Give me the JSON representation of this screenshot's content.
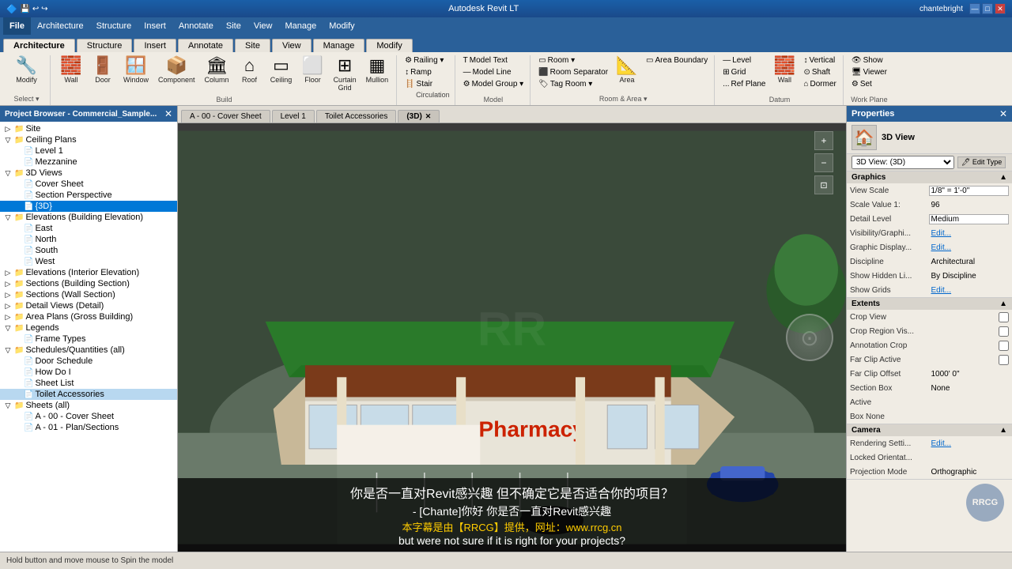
{
  "app": {
    "title": "Autodesk Revit LT",
    "user": "chantebright"
  },
  "titlebar": {
    "controls": [
      "—",
      "□",
      "✕"
    ]
  },
  "menubar": {
    "items": [
      "File",
      "Architecture",
      "Structure",
      "Insert",
      "Annotate",
      "Site",
      "View",
      "Manage",
      "Modify"
    ]
  },
  "ribbon": {
    "active_tab": "Architecture",
    "groups": [
      {
        "label": "",
        "items": [
          {
            "icon": "🔧",
            "label": "Modify"
          }
        ]
      },
      {
        "label": "Build",
        "items": [
          {
            "icon": "🧱",
            "label": "Wall"
          },
          {
            "icon": "🚪",
            "label": "Door"
          },
          {
            "icon": "🪟",
            "label": "Window"
          },
          {
            "icon": "📦",
            "label": "Component"
          },
          {
            "icon": "🏛",
            "label": "Column"
          },
          {
            "icon": "🏠",
            "label": "Roof"
          },
          {
            "icon": "▭",
            "label": "Ceiling"
          },
          {
            "icon": "⬜",
            "label": "Floor"
          },
          {
            "icon": "⬛",
            "label": "Curtain Grid"
          },
          {
            "icon": "▦",
            "label": "Mullion"
          }
        ]
      },
      {
        "label": "",
        "items": [
          {
            "icon": "⚙",
            "label": "Railing"
          },
          {
            "icon": "↕",
            "label": "Ramp"
          },
          {
            "icon": "🪜",
            "label": "Stair Circulation"
          }
        ]
      },
      {
        "label": "Model",
        "items": [
          {
            "icon": "T",
            "label": "Model Text"
          },
          {
            "icon": "—",
            "label": "Model Line"
          },
          {
            "icon": "⚙",
            "label": "Model Group"
          }
        ]
      },
      {
        "label": "Room & Area",
        "items": [
          {
            "icon": "▭",
            "label": "Room"
          },
          {
            "icon": "⬛",
            "label": "Room Separator"
          },
          {
            "icon": "🏷",
            "label": "Tag Room"
          },
          {
            "icon": "📐",
            "label": "Area"
          },
          {
            "icon": "▭",
            "label": "Area Boundary"
          }
        ]
      }
    ],
    "stair_label": "Stair",
    "circulation_label": "Circulation"
  },
  "project_browser": {
    "title": "Project Browser - Commercial_Sample...",
    "tree": [
      {
        "level": 0,
        "label": "Site",
        "type": "item",
        "expanded": false
      },
      {
        "level": 0,
        "label": "Ceiling Plans",
        "type": "group",
        "expanded": true
      },
      {
        "level": 1,
        "label": "Level 1",
        "type": "item"
      },
      {
        "level": 1,
        "label": "Mezzanine",
        "type": "item"
      },
      {
        "level": 0,
        "label": "3D Views",
        "type": "group",
        "expanded": true
      },
      {
        "level": 1,
        "label": "Cover Sheet",
        "type": "item"
      },
      {
        "level": 1,
        "label": "Section Perspective",
        "type": "item"
      },
      {
        "level": 1,
        "label": "{3D}",
        "type": "item",
        "selected": true
      },
      {
        "level": 0,
        "label": "Elevations (Building Elevation)",
        "type": "group",
        "expanded": true
      },
      {
        "level": 1,
        "label": "East",
        "type": "item"
      },
      {
        "level": 1,
        "label": "North",
        "type": "item"
      },
      {
        "level": 1,
        "label": "South",
        "type": "item"
      },
      {
        "level": 1,
        "label": "West",
        "type": "item"
      },
      {
        "level": 0,
        "label": "Elevations (Interior Elevation)",
        "type": "group",
        "expanded": false
      },
      {
        "level": 0,
        "label": "Sections (Building Section)",
        "type": "group",
        "expanded": false
      },
      {
        "level": 0,
        "label": "Sections (Wall Section)",
        "type": "group",
        "expanded": false
      },
      {
        "level": 0,
        "label": "Detail Views (Detail)",
        "type": "group",
        "expanded": false
      },
      {
        "level": 0,
        "label": "Area Plans (Gross Building)",
        "type": "group",
        "expanded": false
      },
      {
        "level": 0,
        "label": "Legends",
        "type": "group",
        "expanded": true
      },
      {
        "level": 1,
        "label": "Frame Types",
        "type": "item"
      },
      {
        "level": 0,
        "label": "Schedules/Quantities (all)",
        "type": "group",
        "expanded": true
      },
      {
        "level": 1,
        "label": "Door Schedule",
        "type": "item"
      },
      {
        "level": 1,
        "label": "How Do I",
        "type": "item"
      },
      {
        "level": 1,
        "label": "Sheet List",
        "type": "item"
      },
      {
        "level": 1,
        "label": "Toilet Accessories",
        "type": "item",
        "highlighted": true
      },
      {
        "level": 0,
        "label": "Sheets (all)",
        "type": "group",
        "expanded": true
      },
      {
        "level": 1,
        "label": "A - 00 - Cover Sheet",
        "type": "item"
      },
      {
        "level": 1,
        "label": "A - 01 - Plan/Sections",
        "type": "item"
      }
    ]
  },
  "tabs": [
    {
      "label": "A - 00 - Cover Sheet",
      "active": false,
      "closeable": false
    },
    {
      "label": "Level 1",
      "active": false,
      "closeable": false
    },
    {
      "label": "Toilet Accessories",
      "active": false,
      "closeable": false
    },
    {
      "label": "(3D)",
      "active": true,
      "closeable": true
    }
  ],
  "viewport": {
    "building_label": "Pharmacy",
    "watermark": "RR"
  },
  "properties": {
    "title": "Properties",
    "close": "✕",
    "view_icon": "🏠",
    "view_type": "3D View",
    "toolbar": {
      "dropdown_label": "3D View: (3D)",
      "edit_type_label": "Edit Type"
    },
    "sections": [
      {
        "name": "Graphics",
        "expanded": true,
        "rows": [
          {
            "label": "View Scale",
            "value": "1/8\" = 1'-0\"",
            "editable": true
          },
          {
            "label": "Scale Value  1:",
            "value": "96",
            "editable": false
          },
          {
            "label": "Detail Level",
            "value": "Medium",
            "editable": true
          },
          {
            "label": "Visibility/Graphi...",
            "value": "Edit...",
            "link": true
          },
          {
            "label": "Graphic Display...",
            "value": "Edit...",
            "link": true
          },
          {
            "label": "Discipline",
            "value": "Architectural",
            "editable": false
          },
          {
            "label": "Show Hidden Li...",
            "value": "By Discipline",
            "editable": false
          },
          {
            "label": "Show Grids",
            "value": "Edit...",
            "link": true
          }
        ]
      },
      {
        "name": "Extents",
        "expanded": true,
        "rows": [
          {
            "label": "Crop View",
            "value": "☐",
            "checkbox": true
          },
          {
            "label": "Crop Region Vis...",
            "value": "☐",
            "checkbox": true
          },
          {
            "label": "Annotation Crop",
            "value": "☐",
            "checkbox": true
          },
          {
            "label": "Far Clip Active",
            "value": "☐",
            "checkbox": true
          },
          {
            "label": "Far Clip Offset",
            "value": "1000' 0\"",
            "editable": false
          },
          {
            "label": "Section Box",
            "value": "None",
            "editable": false
          },
          {
            "label": "Active",
            "value": "",
            "editable": false
          },
          {
            "label": "Box None",
            "value": "",
            "editable": false
          }
        ]
      },
      {
        "name": "Camera",
        "expanded": true,
        "rows": [
          {
            "label": "Rendering Setti...",
            "value": "Edit...",
            "link": true
          },
          {
            "label": "Locked Orientat...",
            "value": "",
            "editable": false
          },
          {
            "label": "Projection Mode",
            "value": "Orthographic",
            "editable": false
          }
        ]
      }
    ]
  },
  "subtitles": {
    "line1": "你是否一直对Revit感兴趣  但不确定它是否适合你的项目？",
    "line2": "- [Chante]你好 你是否一直对Revit感兴趣",
    "line3": "本字幕是由【RRCG】提供，网址：www.rrcg.cn",
    "line4": "but were not sure if it is right for your projects?"
  },
  "statusbar": {
    "text": "Hold button and move mouse to Spin the model"
  }
}
